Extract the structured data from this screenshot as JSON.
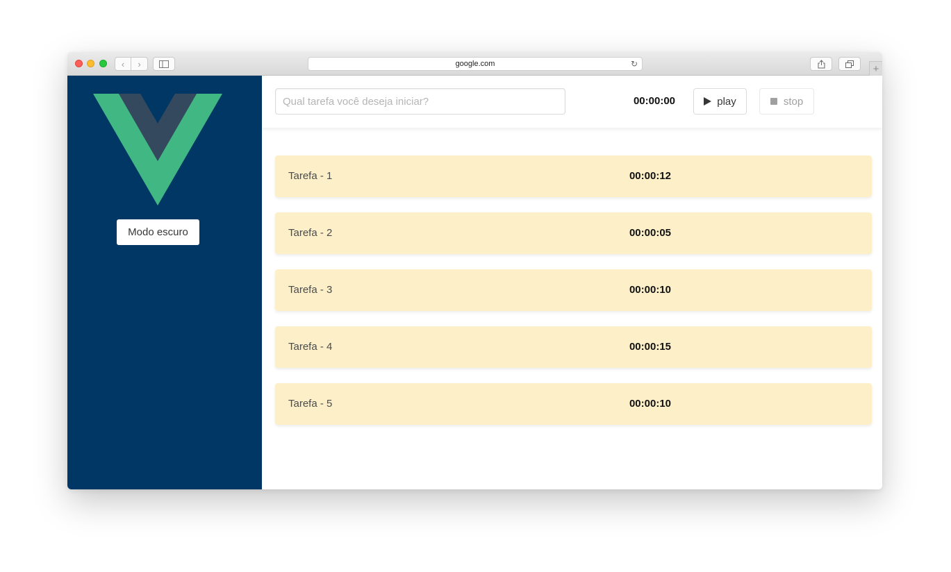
{
  "browser": {
    "url": "google.com",
    "back_icon": "chevron-left-icon",
    "forward_icon": "chevron-right-icon",
    "sidebar_icon": "sidebar-icon",
    "share_icon": "share-icon",
    "tabs_icon": "tabs-icon",
    "new_tab_icon": "plus-icon",
    "reload_icon": "reload-icon"
  },
  "sidebar": {
    "logo_icon": "vue-logo-icon",
    "theme_button_label": "Modo escuro",
    "background_color": "#003764"
  },
  "toolbar": {
    "task_input_placeholder": "Qual tarefa você deseja iniciar?",
    "task_input_value": "",
    "timer": "00:00:00",
    "play_label": "play",
    "stop_label": "stop"
  },
  "tasks": [
    {
      "name": "Tarefa - 1",
      "duration": "00:00:12"
    },
    {
      "name": "Tarefa - 2",
      "duration": "00:00:05"
    },
    {
      "name": "Tarefa - 3",
      "duration": "00:00:10"
    },
    {
      "name": "Tarefa - 4",
      "duration": "00:00:15"
    },
    {
      "name": "Tarefa - 5",
      "duration": "00:00:10"
    }
  ],
  "colors": {
    "vue_green": "#41b883",
    "vue_dark": "#35495e",
    "task_row_bg": "#fdf0c9"
  }
}
